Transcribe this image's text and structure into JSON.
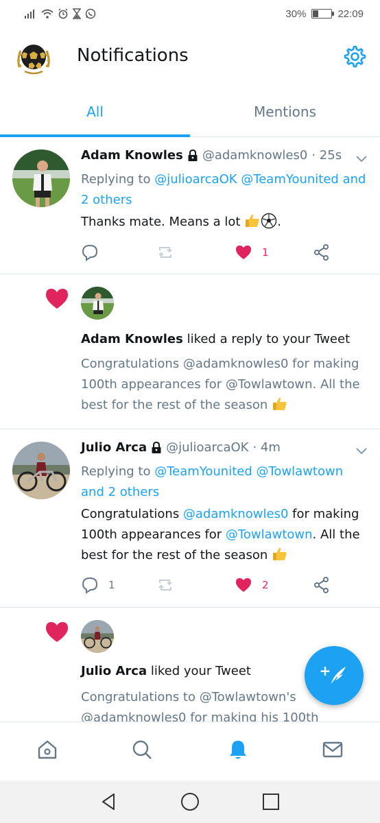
{
  "status_bar": {
    "battery_percent_text": "30%",
    "battery_level": 0.3,
    "time": "22:09",
    "icons": [
      "signal-icon",
      "wifi-icon",
      "alarm-icon",
      "hourglass-icon",
      "whatsapp-icon"
    ]
  },
  "header": {
    "title": "Notifications",
    "logo": "football-logo",
    "settings_icon": "gear-icon"
  },
  "tabs": [
    {
      "label": "All",
      "active": true
    },
    {
      "label": "Mentions",
      "active": false
    }
  ],
  "feed": {
    "tweet1": {
      "name": "Adam Knowles",
      "handle": "@adamknowles0",
      "time": "· 25s",
      "reply_prefix": "Replying to ",
      "reply_to": "@julioarcaOK @TeamYounited and 2 others",
      "text": "Thanks mate. Means a lot ",
      "likes": "1"
    },
    "like1": {
      "text_name": "Adam Knowles",
      "text_action": " liked a reply to your Tweet",
      "quote": "Congratulations @adamknowles0  for making 100th appearances for @Towlawtown. All the best for the rest of the season "
    },
    "tweet2": {
      "name": "Julio Arca",
      "handle": "@julioarcaOK",
      "time": "· 4m",
      "reply_prefix": "Replying to ",
      "reply_to": "@TeamYounited @Towlawtown and 2 others",
      "t1": "Congratulations ",
      "m1": "@adamknowles0",
      "t2": "  for making 100th appearances for ",
      "m2": "@Towlawtown",
      "t3": ". All the best for the rest of the season ",
      "replies": "1",
      "likes": "2"
    },
    "like2": {
      "text_name": "Julio Arca",
      "text_action": " liked your Tweet",
      "quote": "Congratulations to @Towlawtown's @adamknowles0 for making his 100th"
    }
  },
  "fab": {
    "label": "+",
    "icon": "quill-icon"
  },
  "bottom_nav": [
    "home-icon",
    "search-icon",
    "bell-icon",
    "mail-icon"
  ],
  "colors": {
    "accent": "#1da1f2",
    "like": "#e0245e",
    "secondary": "#657786"
  }
}
